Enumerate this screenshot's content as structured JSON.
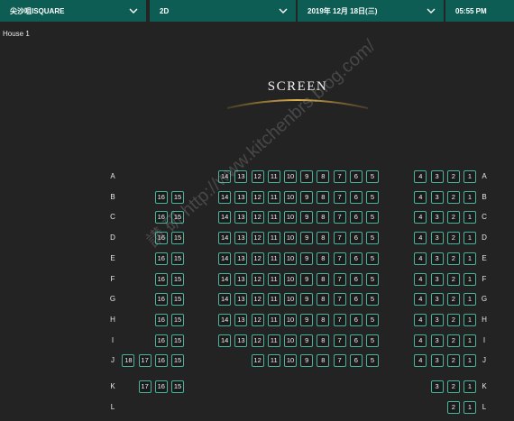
{
  "topbar": {
    "cinema": "尖沙咀ISQUARE",
    "format": "2D",
    "date": "2019年 12月 18日(三)",
    "time": "05:55 PM",
    "accent_color": "#0e5d55",
    "dropdown_icon": "chevron-down-icon"
  },
  "house": "House 1",
  "screen_label": "SCREEN",
  "watermark": "講 研 http://www.kitchenbrs.blog.com/",
  "seat_map": {
    "rows": [
      {
        "label": "A",
        "left_block": [],
        "mid_block": [
          "14",
          "13",
          "12",
          "11",
          "10",
          "9",
          "8",
          "7",
          "6",
          "5"
        ],
        "right_block": [
          "4",
          "3",
          "2",
          "1"
        ]
      },
      {
        "label": "B",
        "left_block": [
          "16",
          "15"
        ],
        "mid_block": [
          "14",
          "13",
          "12",
          "11",
          "10",
          "9",
          "8",
          "7",
          "6",
          "5"
        ],
        "right_block": [
          "4",
          "3",
          "2",
          "1"
        ]
      },
      {
        "label": "C",
        "left_block": [
          "16",
          "15"
        ],
        "mid_block": [
          "14",
          "13",
          "12",
          "11",
          "10",
          "9",
          "8",
          "7",
          "6",
          "5"
        ],
        "right_block": [
          "4",
          "3",
          "2",
          "1"
        ]
      },
      {
        "label": "D",
        "left_block": [
          "16",
          "15"
        ],
        "mid_block": [
          "14",
          "13",
          "12",
          "11",
          "10",
          "9",
          "8",
          "7",
          "6",
          "5"
        ],
        "right_block": [
          "4",
          "3",
          "2",
          "1"
        ]
      },
      {
        "label": "E",
        "left_block": [
          "16",
          "15"
        ],
        "mid_block": [
          "14",
          "13",
          "12",
          "11",
          "10",
          "9",
          "8",
          "7",
          "6",
          "5"
        ],
        "right_block": [
          "4",
          "3",
          "2",
          "1"
        ]
      },
      {
        "label": "F",
        "left_block": [
          "16",
          "15"
        ],
        "mid_block": [
          "14",
          "13",
          "12",
          "11",
          "10",
          "9",
          "8",
          "7",
          "6",
          "5"
        ],
        "right_block": [
          "4",
          "3",
          "2",
          "1"
        ]
      },
      {
        "label": "G",
        "left_block": [
          "16",
          "15"
        ],
        "mid_block": [
          "14",
          "13",
          "12",
          "11",
          "10",
          "9",
          "8",
          "7",
          "6",
          "5"
        ],
        "right_block": [
          "4",
          "3",
          "2",
          "1"
        ]
      },
      {
        "label": "H",
        "left_block": [
          "16",
          "15"
        ],
        "mid_block": [
          "14",
          "13",
          "12",
          "11",
          "10",
          "9",
          "8",
          "7",
          "6",
          "5"
        ],
        "right_block": [
          "4",
          "3",
          "2",
          "1"
        ]
      },
      {
        "label": "I",
        "left_block": [
          "16",
          "15"
        ],
        "mid_block": [
          "14",
          "13",
          "12",
          "11",
          "10",
          "9",
          "8",
          "7",
          "6",
          "5"
        ],
        "right_block": [
          "4",
          "3",
          "2",
          "1"
        ]
      },
      {
        "label": "J",
        "left_block": [
          "18",
          "17",
          "16",
          "15"
        ],
        "mid_block": [
          "12",
          "11",
          "10",
          "9",
          "8",
          "7",
          "6",
          "5"
        ],
        "right_block": [
          "4",
          "3",
          "2",
          "1"
        ]
      },
      {
        "label": "K",
        "left_block": [
          "17",
          "16",
          "15"
        ],
        "mid_block": [],
        "right_block": [
          "3",
          "2",
          "1"
        ]
      },
      {
        "label": "L",
        "left_block": [],
        "mid_block": [],
        "right_block": [
          "2",
          "1"
        ]
      }
    ]
  }
}
